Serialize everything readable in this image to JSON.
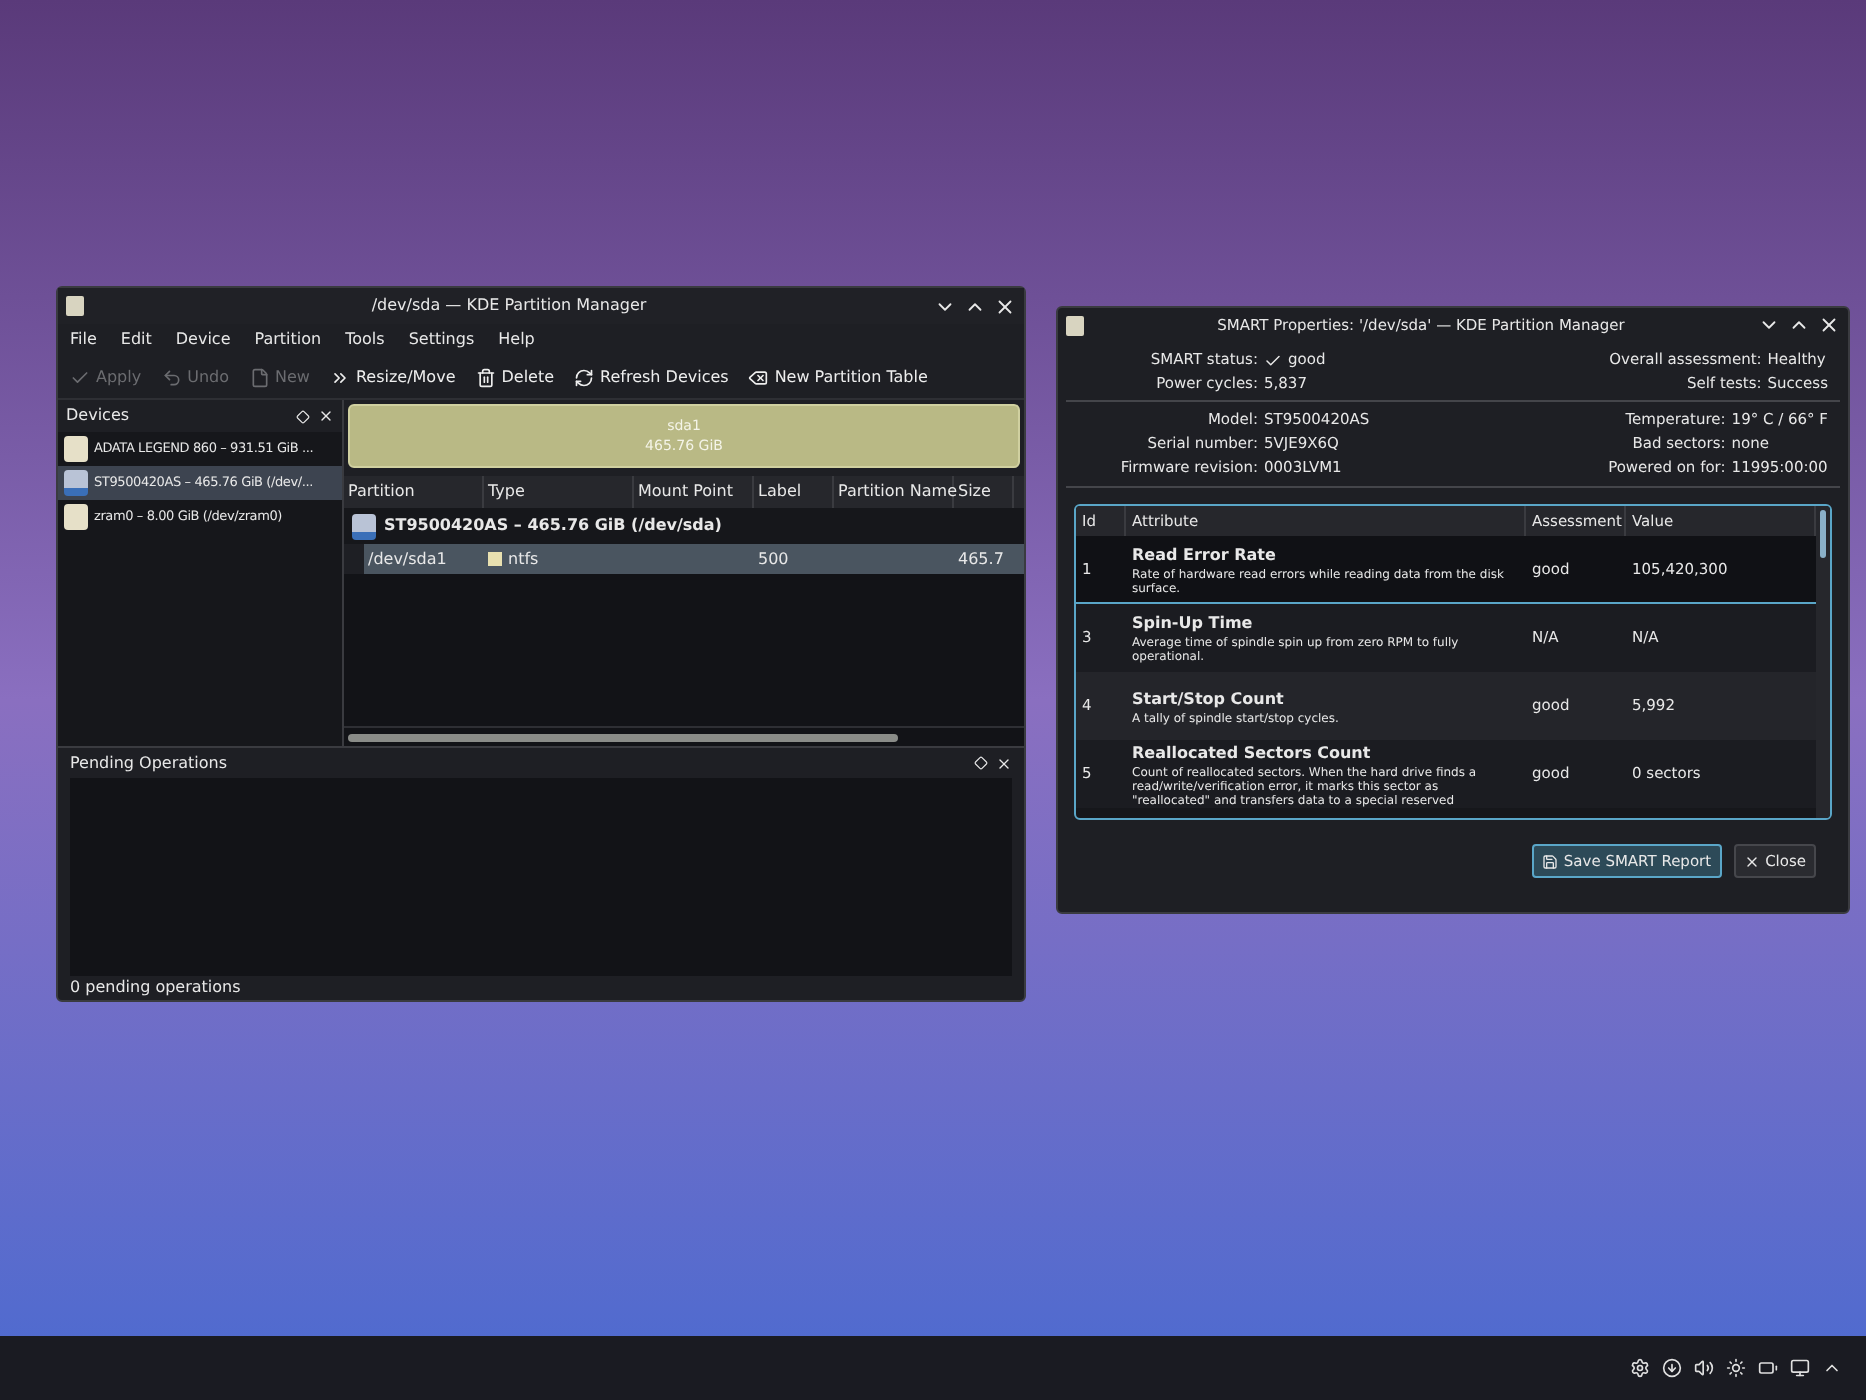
{
  "partition_manager": {
    "title": "/dev/sda — KDE Partition Manager",
    "menu": [
      "File",
      "Edit",
      "Device",
      "Partition",
      "Tools",
      "Settings",
      "Help"
    ],
    "toolbar": [
      {
        "label": "Apply",
        "kind": "apply",
        "disabled": true
      },
      {
        "label": "Undo",
        "kind": "undo",
        "disabled": true
      },
      {
        "label": "New",
        "kind": "new",
        "disabled": true
      },
      {
        "label": "Resize/Move",
        "kind": "resize",
        "disabled": false
      },
      {
        "label": "Delete",
        "kind": "delete",
        "disabled": false
      },
      {
        "label": "Refresh Devices",
        "kind": "refresh",
        "disabled": false
      },
      {
        "label": "New Partition Table",
        "kind": "table",
        "disabled": false
      }
    ],
    "devices_panel": {
      "title": "Devices",
      "items": [
        {
          "label": "ADATA LEGEND 860 – 931.51 GiB ...",
          "selected": false
        },
        {
          "label": "ST9500420AS – 465.76 GiB (/dev/...",
          "selected": true
        },
        {
          "label": "zram0 – 8.00 GiB (/dev/zram0)",
          "selected": false
        }
      ]
    },
    "partition_bar": {
      "name": "sda1",
      "size": "465.76 GiB"
    },
    "table": {
      "columns": [
        "Partition",
        "Type",
        "Mount Point",
        "Label",
        "Partition Name",
        "Size"
      ],
      "disk_row": "ST9500420AS – 465.76 GiB (/dev/sda)",
      "rows": [
        {
          "partition": "/dev/sda1",
          "type": "ntfs",
          "label": "500",
          "size": "465.7",
          "selected": true
        }
      ]
    },
    "pending": {
      "title": "Pending Operations",
      "status": "0 pending operations"
    }
  },
  "smart_dialog": {
    "title": "SMART Properties: '/dev/sda' — KDE Partition Manager",
    "summary_left": [
      {
        "label": "SMART status:",
        "value": "good",
        "check": true
      },
      {
        "label": "Power cycles:",
        "value": "5,837",
        "check": false
      }
    ],
    "summary_right": [
      {
        "label": "Overall assessment:",
        "value": "Healthy"
      },
      {
        "label": "Self tests:",
        "value": "Success"
      }
    ],
    "details_left": [
      {
        "label": "Model:",
        "value": "ST9500420AS"
      },
      {
        "label": "Serial number:",
        "value": "5VJE9X6Q"
      },
      {
        "label": "Firmware revision:",
        "value": "0003LVM1"
      }
    ],
    "details_right": [
      {
        "label": "Temperature:",
        "value": "19° C / 66° F"
      },
      {
        "label": "Bad sectors:",
        "value": "none"
      },
      {
        "label": "Powered on for:",
        "value": "11995:00:00"
      }
    ],
    "table": {
      "columns": [
        "Id",
        "Attribute",
        "Assessment",
        "Value"
      ],
      "rows": [
        {
          "id": "1",
          "name": "Read Error Rate",
          "description": "Rate of hardware read errors while reading data from the disk surface.",
          "assessment": "good",
          "value": "105,420,300",
          "selected": true
        },
        {
          "id": "3",
          "name": "Spin-Up Time",
          "description": "Average time of spindle spin up from zero RPM to fully operational.",
          "assessment": "N/A",
          "value": "N/A",
          "selected": false
        },
        {
          "id": "4",
          "name": "Start/Stop Count",
          "description": "A tally of spindle start/stop cycles.",
          "assessment": "good",
          "value": "5,992",
          "selected": false
        },
        {
          "id": "5",
          "name": "Reallocated Sectors Count",
          "description": "Count of reallocated sectors. When the hard drive finds a read/write/verification error, it marks this sector as \"reallocated\" and transfers data to a special reserved",
          "assessment": "good",
          "value": "0 sectors",
          "selected": false
        }
      ]
    },
    "buttons": [
      {
        "label": "Save SMART Report",
        "kind": "save",
        "default": true
      },
      {
        "label": "Close",
        "kind": "close",
        "default": false
      }
    ]
  }
}
